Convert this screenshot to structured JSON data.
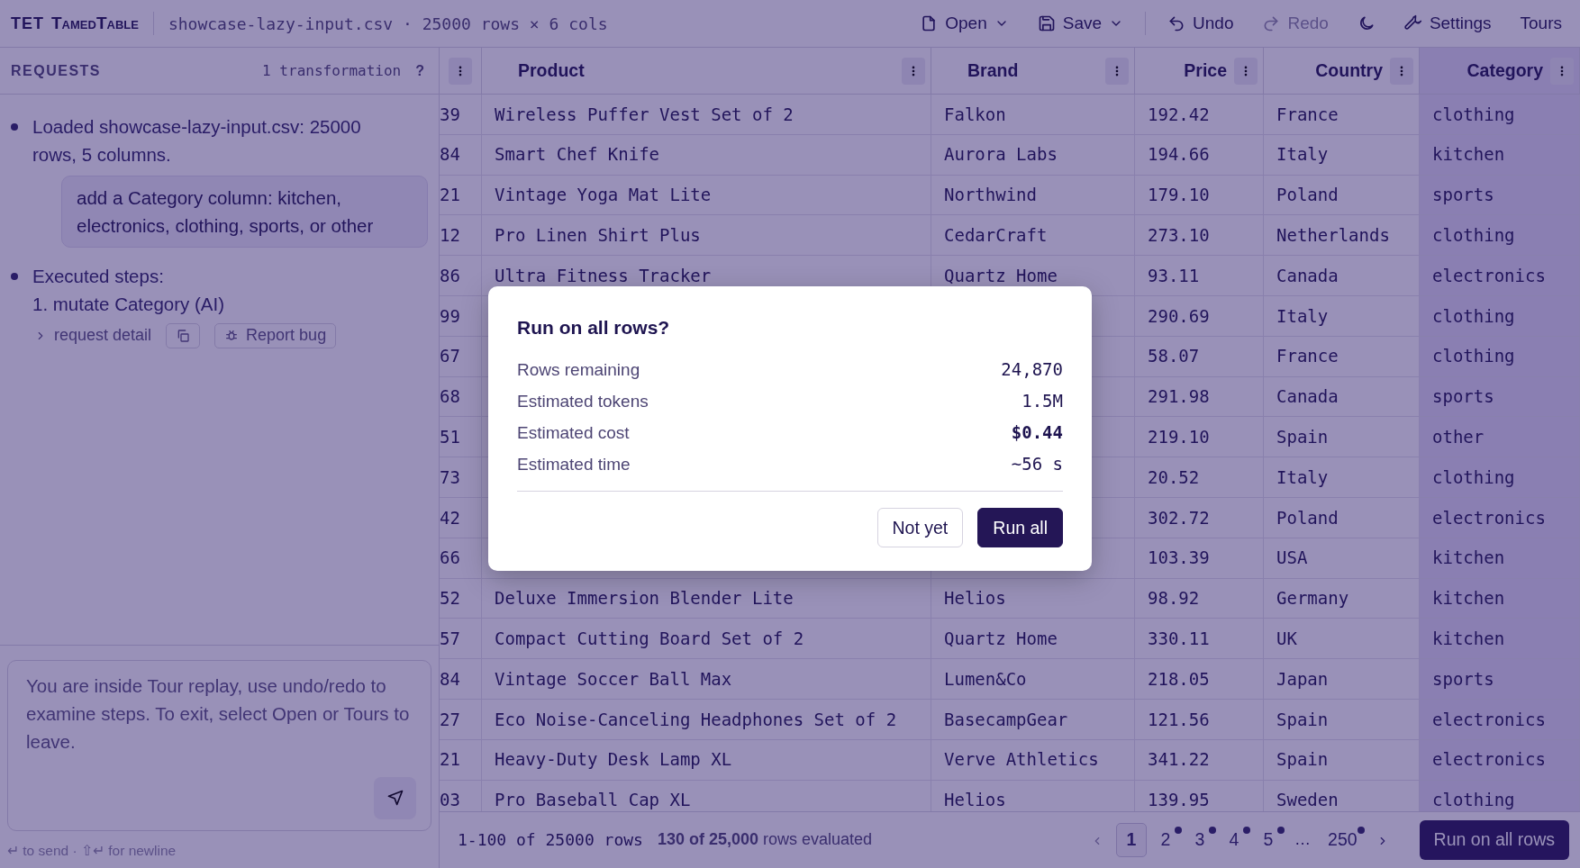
{
  "app": {
    "logo": "TET",
    "name": "TamedTable",
    "file_info": "showcase-lazy-input.csv · 25000 rows × 6 cols"
  },
  "toolbar": [
    {
      "label": "Open",
      "kind": "dropdown",
      "disabled": false
    },
    {
      "label": "Save",
      "kind": "dropdown",
      "disabled": false
    },
    {
      "label": "Undo",
      "kind": "action",
      "disabled": false
    },
    {
      "label": "Redo",
      "kind": "action",
      "disabled": true
    },
    {
      "kind": "theme",
      "disabled": false
    },
    {
      "label": "Settings",
      "kind": "action",
      "disabled": false
    },
    {
      "label": "Tours",
      "kind": "plain",
      "disabled": false
    }
  ],
  "requests": {
    "title": "REQUESTS",
    "count": "1 transformation",
    "help": "?",
    "messages": [
      {
        "kind": "system",
        "text": "Loaded showcase-lazy-input.csv: 25000 rows, 5 columns."
      },
      {
        "kind": "user",
        "text": "add a Category column: kitchen, electronics, clothing, sports, or other"
      },
      {
        "kind": "system",
        "text": "Executed steps:",
        "steps": [
          "1. mutate Category (AI)"
        ]
      }
    ],
    "detail_link": "request detail",
    "report_button": "Report bug"
  },
  "composer": {
    "placeholder": "You are inside Tour replay, use undo/redo to examine steps. To exit, select Open or Tours to leave.",
    "hint": "↵ to send · ⇧↵ for newline"
  },
  "table": {
    "columns": [
      {
        "label": "Product",
        "highlighted": false
      },
      {
        "label": "Brand",
        "highlighted": false
      },
      {
        "label": "Price",
        "highlighted": false
      },
      {
        "label": "Country",
        "highlighted": false
      },
      {
        "label": "Category",
        "highlighted": true
      }
    ],
    "rows": [
      {
        "index": "39",
        "product": "Wireless Puffer Vest Set of 2",
        "brand": "Falkon",
        "price": "192.42",
        "country": "France",
        "category": "clothing"
      },
      {
        "index": "84",
        "product": "Smart Chef Knife",
        "brand": "Aurora Labs",
        "price": "194.66",
        "country": "Italy",
        "category": "kitchen"
      },
      {
        "index": "21",
        "product": "Vintage Yoga Mat Lite",
        "brand": "Northwind",
        "price": "179.10",
        "country": "Poland",
        "category": "sports"
      },
      {
        "index": "12",
        "product": "Pro Linen Shirt Plus",
        "brand": "CedarCraft",
        "price": "273.10",
        "country": "Netherlands",
        "category": "clothing"
      },
      {
        "index": "86",
        "product": "Ultra Fitness Tracker",
        "brand": "Quartz Home",
        "price": "93.11",
        "country": "Canada",
        "category": "electronics"
      },
      {
        "index": "99",
        "price": "290.69",
        "country": "Italy",
        "category": "clothing"
      },
      {
        "index": "67",
        "price": "58.07",
        "country": "France",
        "category": "clothing"
      },
      {
        "index": "68",
        "price": "291.98",
        "country": "Canada",
        "category": "sports"
      },
      {
        "index": "51",
        "price": "219.10",
        "country": "Spain",
        "category": "other"
      },
      {
        "index": "73",
        "price": "20.52",
        "country": "Italy",
        "category": "clothing"
      },
      {
        "index": "42",
        "price": "302.72",
        "country": "Poland",
        "category": "electronics"
      },
      {
        "index": "66",
        "price": "103.39",
        "country": "USA",
        "category": "kitchen"
      },
      {
        "index": "52",
        "product": "Deluxe Immersion Blender Lite",
        "brand": "Helios",
        "price": "98.92",
        "country": "Germany",
        "category": "kitchen"
      },
      {
        "index": "57",
        "product": "Compact Cutting Board Set of 2",
        "brand": "Quartz Home",
        "price": "330.11",
        "country": "UK",
        "category": "kitchen"
      },
      {
        "index": "84",
        "product": "Vintage Soccer Ball Max",
        "brand": "Lumen&Co",
        "price": "218.05",
        "country": "Japan",
        "category": "sports"
      },
      {
        "index": "27",
        "product": "Eco Noise-Canceling Headphones Set of 2",
        "brand": "BasecampGear",
        "price": "121.56",
        "country": "Spain",
        "category": "electronics"
      },
      {
        "index": "21",
        "product": "Heavy-Duty Desk Lamp XL",
        "brand": "Verve Athletics",
        "price": "341.22",
        "country": "Spain",
        "category": "electronics"
      },
      {
        "index": "03",
        "product": "Pro Baseball Cap XL",
        "brand": "Helios",
        "price": "139.95",
        "country": "Sweden",
        "category": "clothing"
      }
    ]
  },
  "footer": {
    "range": "1-100 of 25000 rows",
    "evaluated": "**130 of 25,000** rows evaluated",
    "pages": [
      {
        "kind": "page",
        "label": "1",
        "selected": true,
        "marked": false
      },
      {
        "kind": "page",
        "label": "2",
        "selected": false,
        "marked": true
      },
      {
        "kind": "page",
        "label": "3",
        "selected": false,
        "marked": true
      },
      {
        "kind": "page",
        "label": "4",
        "selected": false,
        "marked": true
      },
      {
        "kind": "page",
        "label": "5",
        "selected": false,
        "marked": true
      },
      {
        "kind": "ellipsis",
        "label": "…"
      },
      {
        "kind": "page",
        "label": "250",
        "selected": false,
        "marked": true
      }
    ],
    "run_button": "Run on all rows"
  },
  "dialog": {
    "title": "Run on all rows?",
    "stats": [
      {
        "label": "Rows remaining",
        "value": "24,870",
        "bold": false
      },
      {
        "label": "Estimated tokens",
        "value": "1.5M",
        "bold": false
      },
      {
        "label": "Estimated cost",
        "value": "$0.44",
        "bold": true
      },
      {
        "label": "Estimated time",
        "value": "~56 s",
        "bold": false
      }
    ],
    "buttons": [
      {
        "label": "Not yet",
        "kind": "secondary"
      },
      {
        "label": "Run all",
        "kind": "primary"
      }
    ]
  }
}
